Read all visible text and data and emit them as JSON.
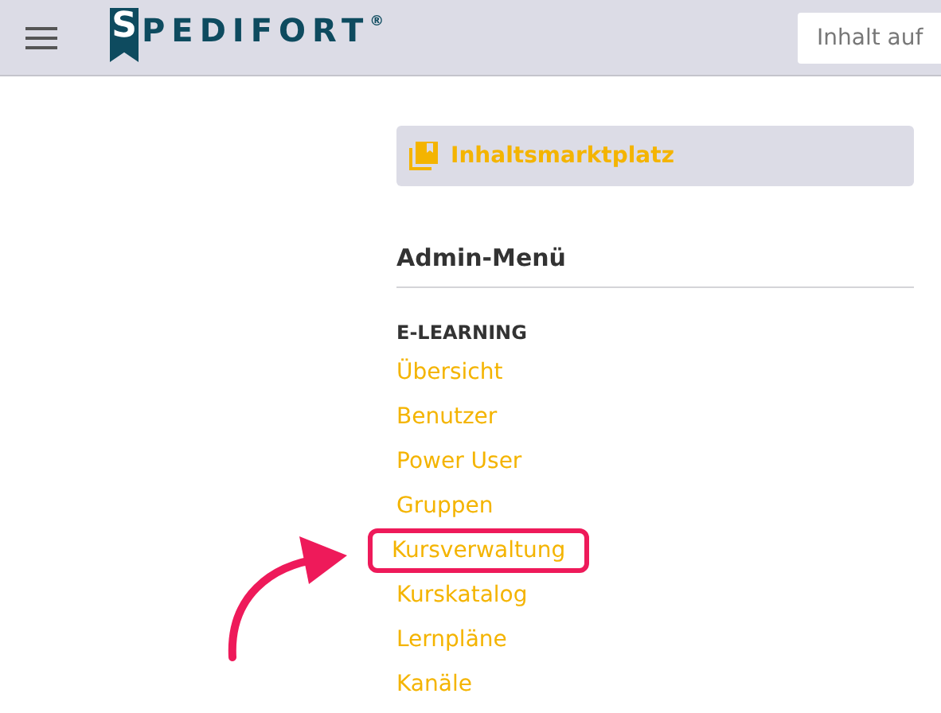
{
  "header": {
    "logo": {
      "initial": "S",
      "rest": "PEDIFORT",
      "mark": "®"
    },
    "search": {
      "placeholder": "Inhalt auf"
    }
  },
  "marketplace_button": {
    "label": "Inhaltsmarktplatz"
  },
  "admin_menu": {
    "title": "Admin-Menü",
    "section": "E-LEARNING",
    "items": [
      {
        "label": "Übersicht",
        "highlighted": false
      },
      {
        "label": "Benutzer",
        "highlighted": false
      },
      {
        "label": "Power User",
        "highlighted": false
      },
      {
        "label": "Gruppen",
        "highlighted": false
      },
      {
        "label": "Kursverwaltung",
        "highlighted": true
      },
      {
        "label": "Kurskatalog",
        "highlighted": false
      },
      {
        "label": "Lernpläne",
        "highlighted": false
      },
      {
        "label": "Kanäle",
        "highlighted": false
      }
    ]
  }
}
